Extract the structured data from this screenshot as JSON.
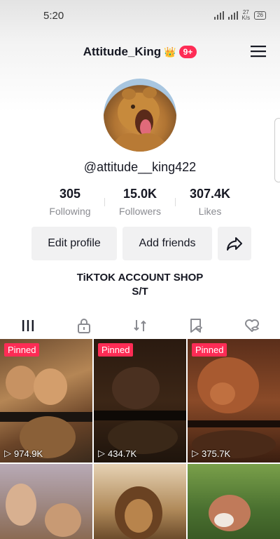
{
  "status": {
    "time": "5:20",
    "speed_value": "27",
    "speed_unit": "K/s",
    "battery": "26"
  },
  "header": {
    "title": "Attitude_King",
    "crown": "👑",
    "badge": "9+"
  },
  "profile": {
    "handle": "@attitude__king422",
    "stats": [
      {
        "value": "305",
        "label": "Following"
      },
      {
        "value": "15.0K",
        "label": "Followers"
      },
      {
        "value": "307.4K",
        "label": "Likes"
      }
    ],
    "edit_label": "Edit profile",
    "add_label": "Add friends",
    "bio_line1": "TiKTOK ACCOUNT SHOP",
    "bio_line2": "S/T"
  },
  "videos": [
    {
      "pinned": "Pinned",
      "views": "974.9K"
    },
    {
      "pinned": "Pinned",
      "views": "434.7K"
    },
    {
      "pinned": "Pinned",
      "views": "375.7K"
    }
  ]
}
